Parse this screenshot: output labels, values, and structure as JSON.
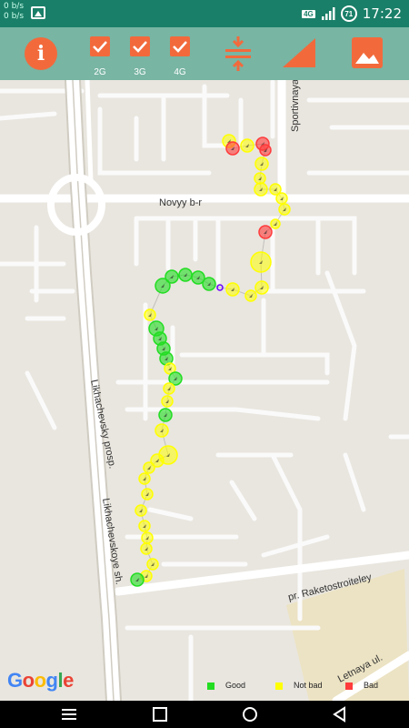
{
  "statusbar": {
    "data_top": "0 b/s",
    "data_bottom": "0 b/s",
    "network_type": "4G",
    "battery_level": "71",
    "time": "17:22"
  },
  "toolbar": {
    "checkbox_2g_label": "2G",
    "checkbox_3g_label": "3G",
    "checkbox_4g_label": "4G",
    "checkbox_2g_checked": true,
    "checkbox_3g_checked": true,
    "checkbox_4g_checked": true,
    "accent_color": "#f26a3c"
  },
  "map": {
    "street_novyy": "Novyy b-r",
    "street_sportivnaya": "Sportivnaya ul.",
    "street_likhachevsky": "Likhachevsky prosp.",
    "street_likhachevskoye": "Likhachevskoye sh.",
    "street_raketostroiteley": "pr. Raketostroiteley",
    "street_letnaya": "Letnaya ul.",
    "attribution": "Google"
  },
  "legend": {
    "good_label": "Good",
    "good_color": "#22dd22",
    "notbad_label": "Not bad",
    "notbad_color": "#ffff00",
    "bad_label": "Bad",
    "bad_color": "#ff3b3b"
  }
}
